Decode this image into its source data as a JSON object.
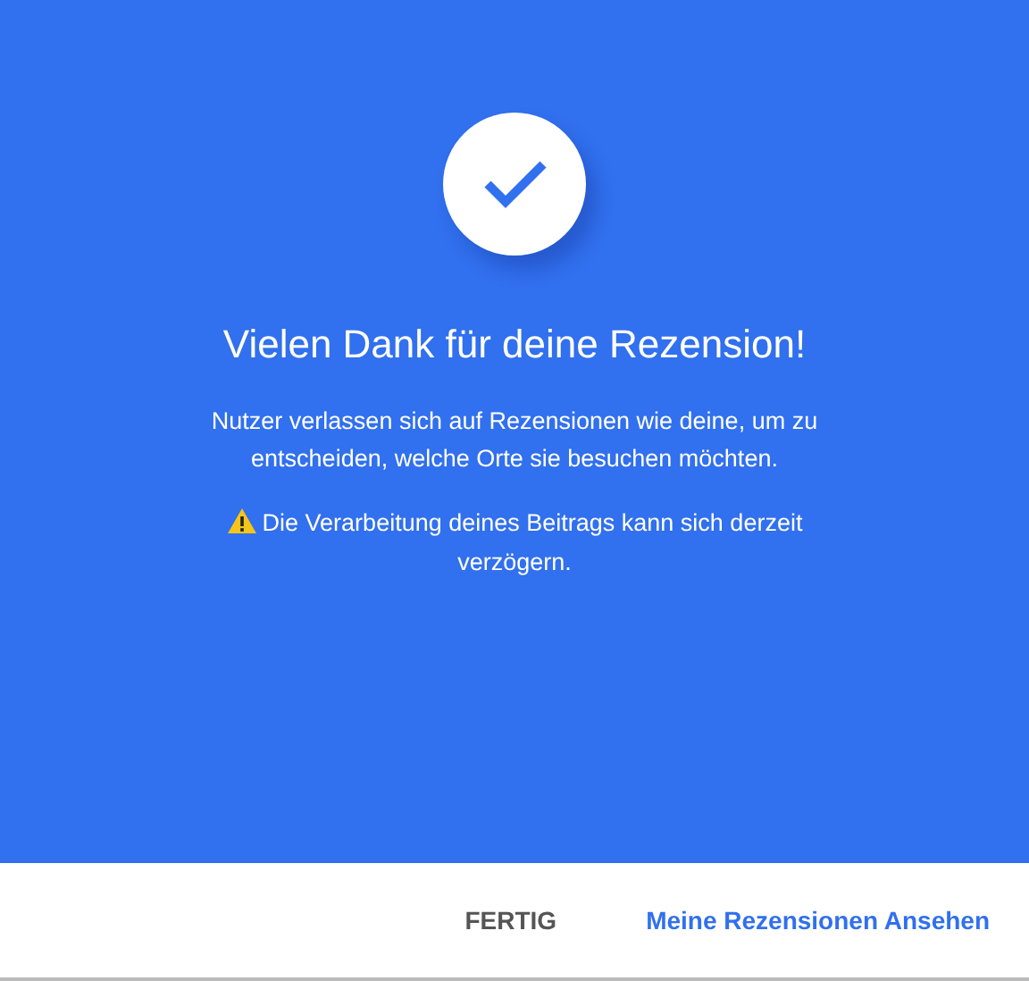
{
  "title": "Vielen Dank für deine Rezension!",
  "message": "Nutzer verlassen sich auf Rezensionen wie deine, um zu entscheiden, welche Orte sie besuchen möchten.",
  "warning": "Die Verarbeitung deines Beitrags kann sich derzeit verzögern.",
  "buttons": [
    {
      "label": "FERTIG",
      "kind": "secondary"
    },
    {
      "label": "Meine Rezensionen Ansehen",
      "kind": "primary"
    }
  ]
}
